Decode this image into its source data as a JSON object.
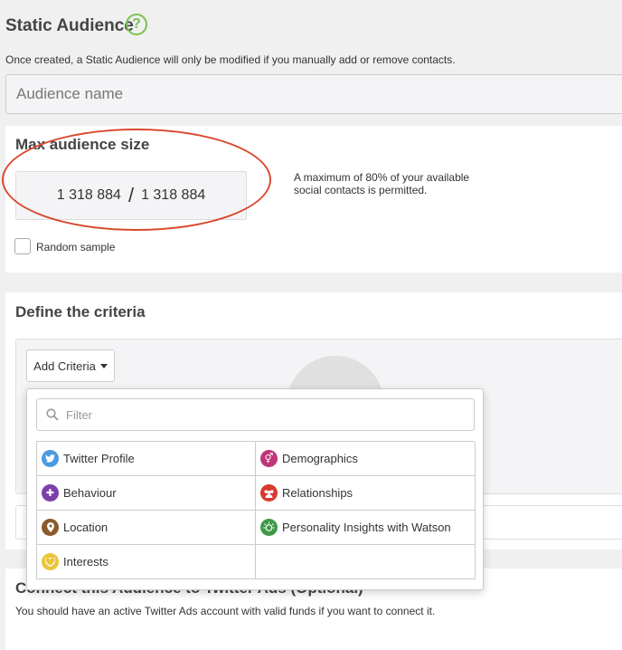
{
  "header": {
    "title": "Static Audience",
    "help_glyph": "?",
    "subtitle": "Once created, a Static Audience will only be modified if you manually add or remove contacts."
  },
  "name_input": {
    "placeholder": "Audience name",
    "value": ""
  },
  "max_size": {
    "title": "Max audience size",
    "current": "1 318 884",
    "separator": "/",
    "total": "1 318 884",
    "note": "A maximum of 80% of your available social contacts is permitted.",
    "random_sample_label": "Random sample",
    "random_sample_checked": false,
    "highlight_color": "#d9482d"
  },
  "criteria": {
    "title": "Define the criteria",
    "add_button_label": "Add Criteria",
    "filter_placeholder": "Filter",
    "options": [
      {
        "label": "Twitter Profile",
        "icon": "twitter-icon",
        "color": "#4a9be0"
      },
      {
        "label": "Demographics",
        "icon": "gender-icon",
        "color": "#c0357a"
      },
      {
        "label": "Behaviour",
        "icon": "puzzle-icon",
        "color": "#7b3fa8"
      },
      {
        "label": "Relationships",
        "icon": "people-icon",
        "color": "#d8392f"
      },
      {
        "label": "Location",
        "icon": "pin-icon",
        "color": "#8a5a2b"
      },
      {
        "label": "Personality Insights with Watson",
        "icon": "watson-icon",
        "color": "#3f9a48"
      },
      {
        "label": "Interests",
        "icon": "heart-icon",
        "color": "#e8c53a"
      }
    ]
  },
  "connect": {
    "title": "Connect this Audience to Twitter Ads (Optional)",
    "text": "You should have an active Twitter Ads account with valid funds if you want to connect it."
  },
  "colors": {
    "accent_green": "#7bc14f",
    "page_bg": "#f0f0f0"
  }
}
